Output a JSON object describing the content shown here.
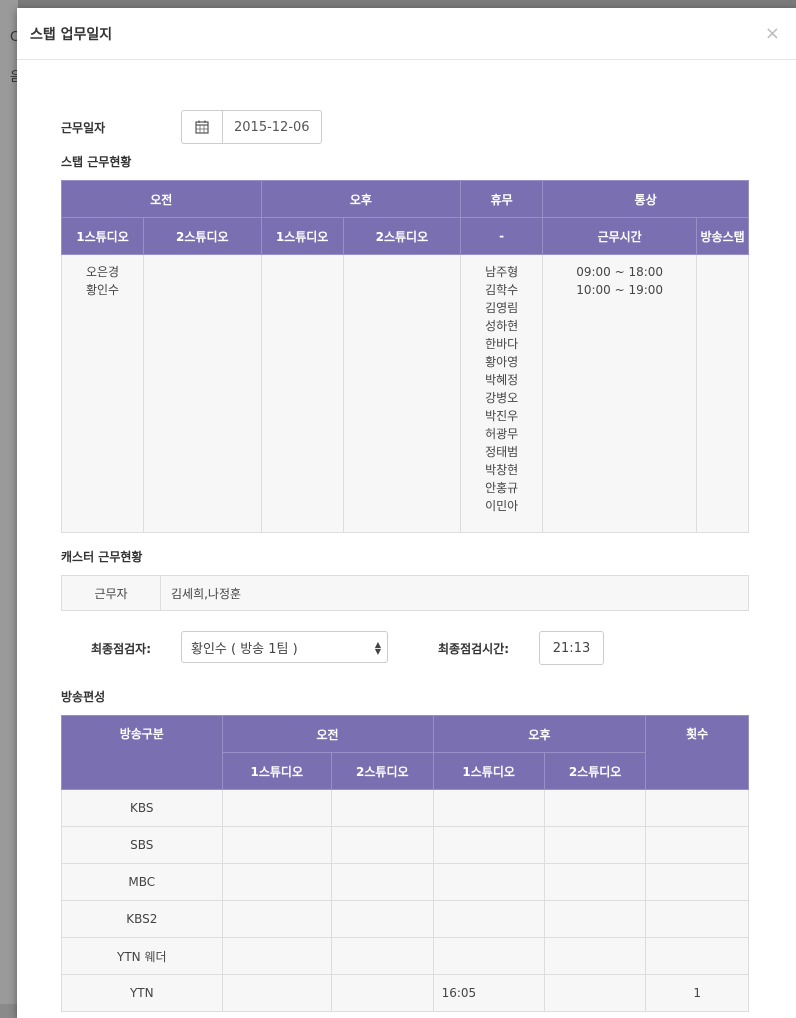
{
  "modal": {
    "title": "스탭 업무일지",
    "close": "×"
  },
  "work_date": {
    "label": "근무일자",
    "value": "2015-12-06"
  },
  "staff": {
    "section_title": "스탭 근무현황",
    "group_headers": [
      "오전",
      "오후",
      "휴무",
      "통상"
    ],
    "col_headers": [
      "1스튜디오",
      "2스튜디오",
      "1스튜디오",
      "2스튜디오",
      "-",
      "근무시간",
      "방송스탭"
    ],
    "am_studio1": [
      "오은경",
      "황인수"
    ],
    "off": [
      "남주형",
      "김학수",
      "김영림",
      "성하현",
      "한바다",
      "황아영",
      "박혜정",
      "강병오",
      "박진우",
      "허광무",
      "정태범",
      "박창현",
      "안홍규",
      "이민아"
    ],
    "hours": [
      "09:00 ~ 18:00",
      "10:00 ~ 19:00"
    ]
  },
  "caster": {
    "section_title": "캐스터 근무현황",
    "key": "근무자",
    "value": "김세희,나정훈"
  },
  "inspector": {
    "label": "최종점검자:",
    "value": "황인수 ( 방송 1팀 )",
    "time_label": "최종점검시간:",
    "time": "21:13"
  },
  "broadcast": {
    "section_title": "방송편성",
    "headers": {
      "category": "방송구분",
      "am": "오전",
      "pm": "오후",
      "count": "횟수",
      "studio1": "1스튜디오",
      "studio2": "2스튜디오"
    },
    "rows": [
      {
        "name": "KBS",
        "am1": "",
        "am2": "",
        "pm1": "",
        "pm2": "",
        "count": ""
      },
      {
        "name": "SBS",
        "am1": "",
        "am2": "",
        "pm1": "",
        "pm2": "",
        "count": ""
      },
      {
        "name": "MBC",
        "am1": "",
        "am2": "",
        "pm1": "",
        "pm2": "",
        "count": ""
      },
      {
        "name": "KBS2",
        "am1": "",
        "am2": "",
        "pm1": "",
        "pm2": "",
        "count": ""
      },
      {
        "name": "YTN 웨더",
        "am1": "",
        "am2": "",
        "pm1": "",
        "pm2": "",
        "count": ""
      },
      {
        "name": "YTN",
        "am1": "",
        "am2": "",
        "pm1": "16:05",
        "pm2": "",
        "count": "1"
      }
    ]
  }
}
